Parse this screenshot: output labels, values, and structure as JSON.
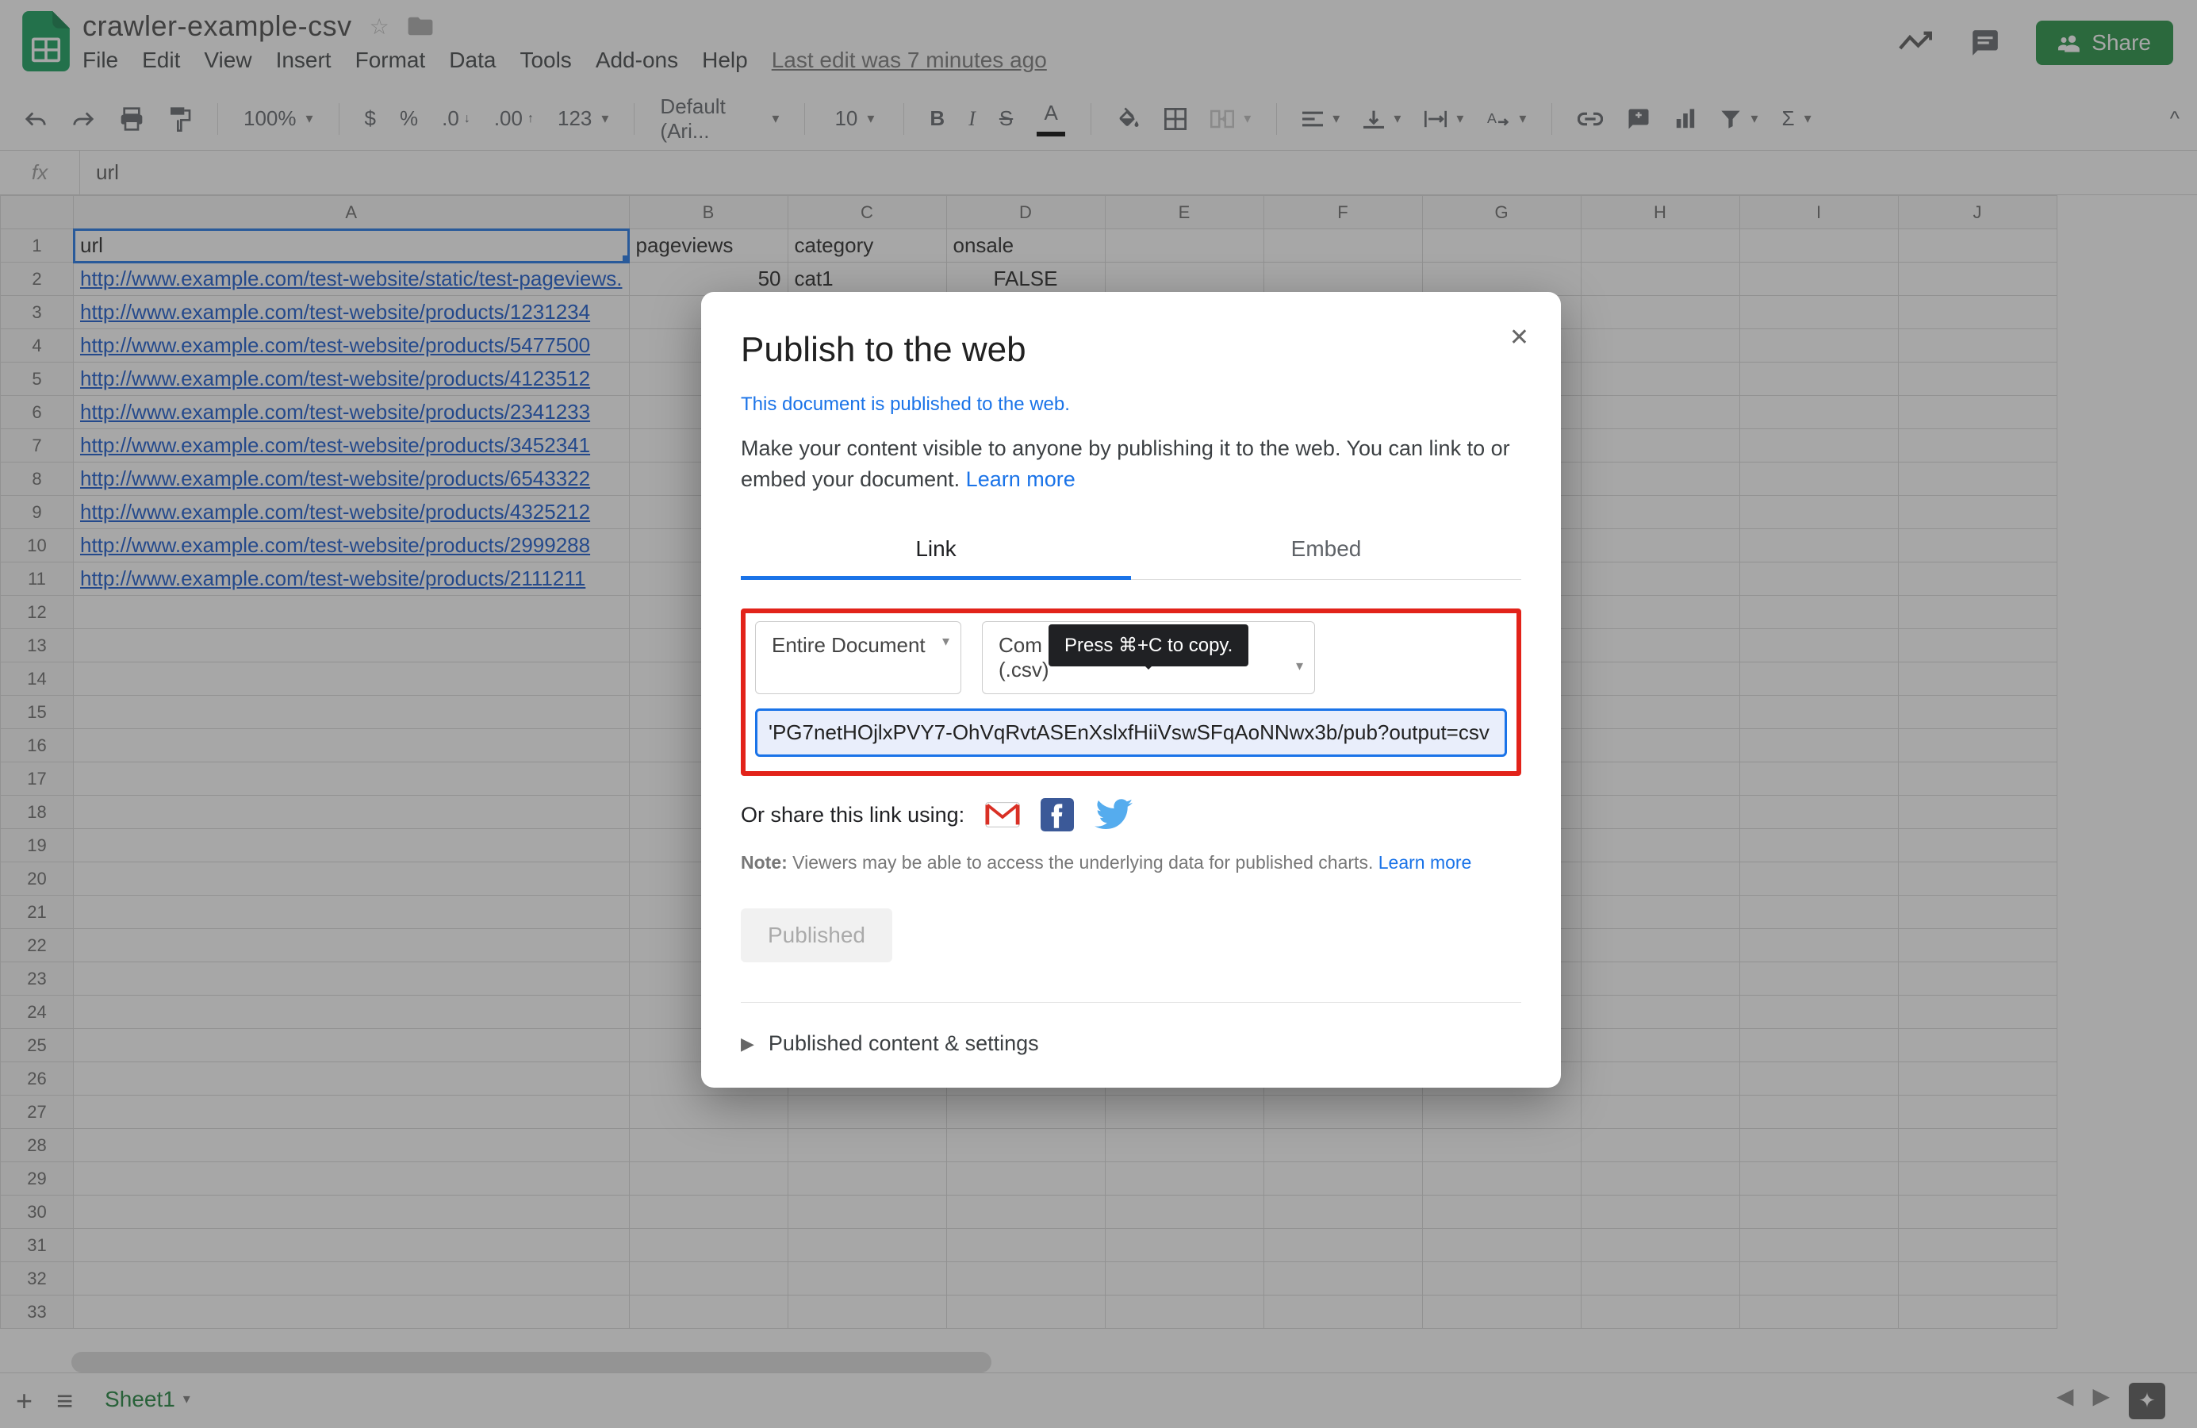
{
  "doc": {
    "title": "crawler-example-csv",
    "last_edit": "Last edit was 7 minutes ago"
  },
  "menus": [
    "File",
    "Edit",
    "View",
    "Insert",
    "Format",
    "Data",
    "Tools",
    "Add-ons",
    "Help"
  ],
  "toolbar": {
    "zoom": "100%",
    "font": "Default (Ari...",
    "fontsize": "10"
  },
  "formula": {
    "label": "fx",
    "value": "url"
  },
  "columns": [
    "A",
    "B",
    "C",
    "D",
    "E",
    "F",
    "G",
    "H",
    "I",
    "J"
  ],
  "row_count": 33,
  "headers": {
    "A": "url",
    "B": "pageviews",
    "C": "category",
    "D": "onsale"
  },
  "rows": [
    {
      "A": "http://www.example.com/test-website/static/test-pageviews.",
      "B": "50",
      "C": "cat1",
      "D": "FALSE"
    },
    {
      "A": "http://www.example.com/test-website/products/1231234"
    },
    {
      "A": "http://www.example.com/test-website/products/5477500"
    },
    {
      "A": "http://www.example.com/test-website/products/4123512"
    },
    {
      "A": "http://www.example.com/test-website/products/2341233"
    },
    {
      "A": "http://www.example.com/test-website/products/3452341"
    },
    {
      "A": "http://www.example.com/test-website/products/6543322"
    },
    {
      "A": "http://www.example.com/test-website/products/4325212"
    },
    {
      "A": "http://www.example.com/test-website/products/2999288"
    },
    {
      "A": "http://www.example.com/test-website/products/2111211"
    }
  ],
  "share_label": "Share",
  "sheet_tab": "Sheet1",
  "modal": {
    "title": "Publish to the web",
    "status": "This document is published to the web.",
    "desc1": "Make your content visible to anyone by publishing it to the web. You can link to or embed your document. ",
    "learn": "Learn more",
    "tab_link": "Link",
    "tab_embed": "Embed",
    "sel_scope": "Entire Document",
    "sel_format_prefix": "Com",
    "sel_format_suffix": "es (.csv)",
    "tooltip": "Press ⌘+C to copy.",
    "url": "'PG7netHOjlxPVY7-OhVqRvtASEnXslxfHiiVswSFqAoNNwx3b/pub?output=csv",
    "share_using": "Or share this link using:",
    "note_label": "Note:",
    "note_text": " Viewers may be able to access the underlying data for published charts. ",
    "note_learn": "Learn more",
    "published_btn": "Published",
    "expand": "Published content & settings"
  }
}
